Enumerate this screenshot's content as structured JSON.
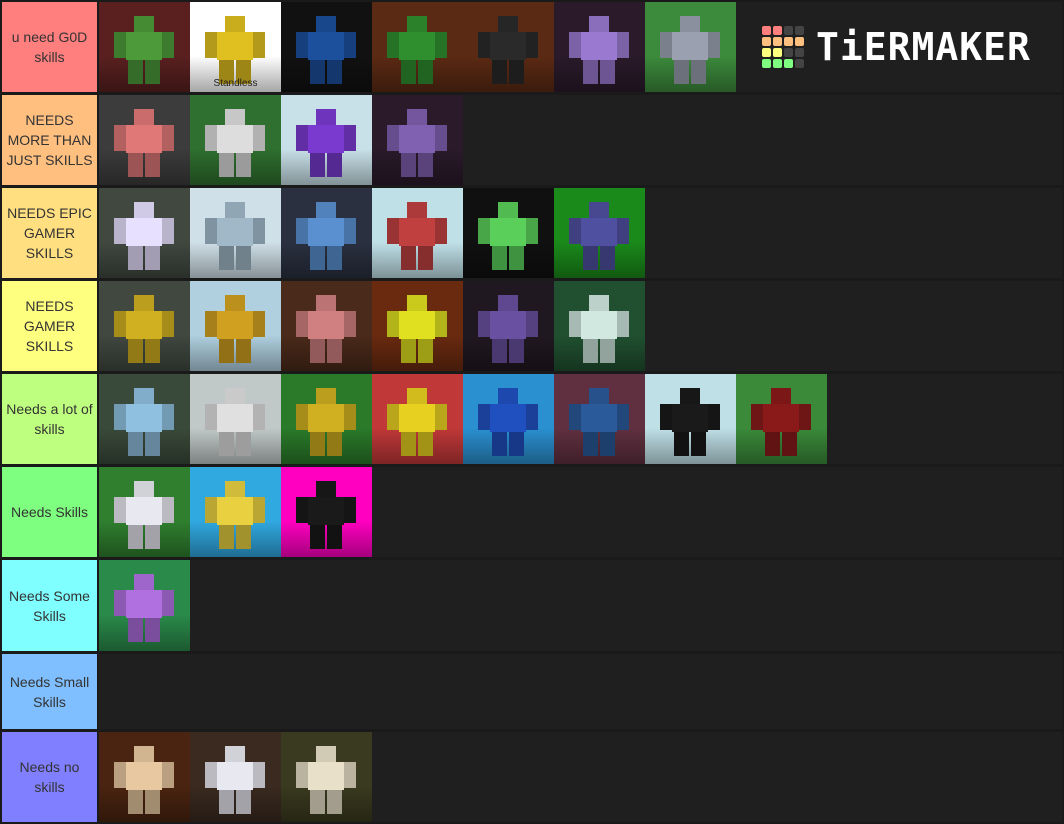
{
  "brand": {
    "name": "TiERMAKER",
    "grid_colors": [
      "#ff7f7f",
      "#ff7f7f",
      "#444444",
      "#444444",
      "#ffbf7f",
      "#ffbf7f",
      "#ffbf7f",
      "#ffbf7f",
      "#ffff7f",
      "#ffff7f",
      "#444444",
      "#444444",
      "#7fff7f",
      "#7fff7f",
      "#7fff7f",
      "#444444"
    ]
  },
  "tiers": [
    {
      "label": "u need G0D skills",
      "color": "#ff7f7f",
      "items": [
        {
          "name": "turtle-stand",
          "bg": "#5a2020",
          "accent": "#4c9a3a"
        },
        {
          "name": "standless",
          "bg": "#ffffff",
          "accent": "#e0c020",
          "caption": "Standless"
        },
        {
          "name": "card-stand",
          "bg": "#111111",
          "accent": "#1c4f9c"
        },
        {
          "name": "sword-user",
          "bg": "#5b2a14",
          "accent": "#2f8f2f"
        },
        {
          "name": "dark-stand",
          "bg": "#5b2a14",
          "accent": "#2a2a2a"
        },
        {
          "name": "purple-stand",
          "bg": "#2a1a2a",
          "accent": "#9a7ad0"
        },
        {
          "name": "revolver",
          "bg": "#3c8a3c",
          "accent": "#9aa0b0"
        }
      ]
    },
    {
      "label": "NEEDS MORE THAN JUST SKILLS",
      "color": "#ffbf7f",
      "items": [
        {
          "name": "pink-blue-stand",
          "bg": "#3c3c3c",
          "accent": "#e07878"
        },
        {
          "name": "hand-stand",
          "bg": "#2f6f2f",
          "accent": "#dddddd"
        },
        {
          "name": "star-platinum-purple",
          "bg": "#c8e0e8",
          "accent": "#7a3ad0"
        },
        {
          "name": "small-purple-stand",
          "bg": "#2a1a2a",
          "accent": "#8060b0"
        }
      ]
    },
    {
      "label": "NEEDS EPIC GAMER SKILLS",
      "color": "#ffdf7f",
      "items": [
        {
          "name": "glowing-stand",
          "bg": "#404840",
          "accent": "#e8e0ff"
        },
        {
          "name": "ice-stand",
          "bg": "#d0e0e8",
          "accent": "#a0b8c8"
        },
        {
          "name": "blue-white-duo",
          "bg": "#2a3040",
          "accent": "#5a90d0"
        },
        {
          "name": "red-white-stand",
          "bg": "#c0e0e8",
          "accent": "#c04040"
        },
        {
          "name": "green-stand",
          "bg": "#101010",
          "accent": "#5ad05a"
        },
        {
          "name": "star-platinum",
          "bg": "#1a8a1a",
          "accent": "#5050a0"
        }
      ]
    },
    {
      "label": "NEEDS GAMER SKILLS",
      "color": "#ffff7f",
      "items": [
        {
          "name": "the-world-gold",
          "bg": "#404840",
          "accent": "#d0b020"
        },
        {
          "name": "gold-stand",
          "bg": "#b0d0e0",
          "accent": "#d0a020"
        },
        {
          "name": "red-checker-stand",
          "bg": "#4a2a1a",
          "accent": "#d08080"
        },
        {
          "name": "yellow-beam",
          "bg": "#6a2a10",
          "accent": "#e0e020"
        },
        {
          "name": "purple-dark-stand",
          "bg": "#201820",
          "accent": "#6a50a0"
        },
        {
          "name": "white-green-stand",
          "bg": "#205030",
          "accent": "#d0e8e0"
        }
      ]
    },
    {
      "label": "Needs a lot of skills",
      "color": "#bfff7f",
      "items": [
        {
          "name": "bunny-stand",
          "bg": "#3a4a3a",
          "accent": "#90c0e0"
        },
        {
          "name": "grey-stand",
          "bg": "#c0c8c8",
          "accent": "#e0e0e0"
        },
        {
          "name": "yellow-fist-user",
          "bg": "#2a7a2a",
          "accent": "#d0b020"
        },
        {
          "name": "gold-on-red",
          "bg": "#c03838",
          "accent": "#e8d020"
        },
        {
          "name": "blue-ice-stand",
          "bg": "#2a90d0",
          "accent": "#2050c0"
        },
        {
          "name": "blue-shirt-user",
          "bg": "#603040",
          "accent": "#2a5a9a"
        },
        {
          "name": "red-eye-stand",
          "bg": "#c0e0e8",
          "accent": "#1a1a1a"
        },
        {
          "name": "red-black-stand",
          "bg": "#3a8a3a",
          "accent": "#8a1a1a"
        }
      ]
    },
    {
      "label": "Needs Skills",
      "color": "#7fff7f",
      "items": [
        {
          "name": "horse-rider",
          "bg": "#2f7f2f",
          "accent": "#e8e8f0"
        },
        {
          "name": "gold-experience",
          "bg": "#30a8e0",
          "accent": "#e8d040"
        },
        {
          "name": "horned-stand",
          "bg": "#ff00c0",
          "accent": "#1a1a1a"
        }
      ]
    },
    {
      "label": "Needs Some Skills",
      "color": "#7fffff",
      "items": [
        {
          "name": "purple-checker-stand",
          "bg": "#2a8a4a",
          "accent": "#b070e0"
        }
      ]
    },
    {
      "label": "Needs Small Skills",
      "color": "#7fbfff",
      "items": []
    },
    {
      "label": "Needs no skills",
      "color": "#7f7fff",
      "items": [
        {
          "name": "paper-stand",
          "bg": "#4a2410",
          "accent": "#e8c8a0"
        },
        {
          "name": "white-armored-stand",
          "bg": "#3a2a20",
          "accent": "#e8e8f0"
        },
        {
          "name": "gold-experience-requiem",
          "bg": "#3a3a20",
          "accent": "#e8e0c8"
        }
      ]
    }
  ]
}
